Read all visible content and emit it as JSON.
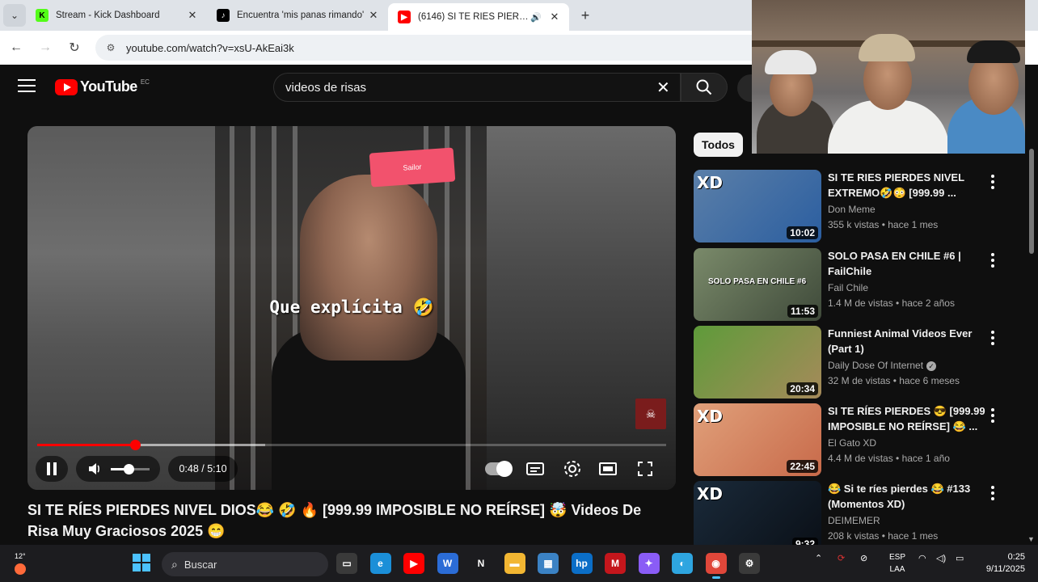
{
  "browser": {
    "tabs": [
      {
        "title": "Stream - Kick Dashboard",
        "favicon": "kick-icon",
        "color": "#53fc18",
        "fav_text": "K"
      },
      {
        "title": "Encuentra 'mis panas rimando'",
        "favicon": "tiktok-icon",
        "color": "#000000",
        "fav_text": "♪"
      },
      {
        "title": "(6146) SI TE RÍES PIERDES N",
        "favicon": "youtube-icon",
        "color": "#ff0000",
        "fav_text": "▶",
        "audio": true
      }
    ],
    "url": "youtube.com/watch?v=xsU-AkEai3k"
  },
  "youtube": {
    "logo_text": "YouTube",
    "country_code": "EC",
    "search_query": "videos de risas"
  },
  "player": {
    "caption": "Que explícita",
    "caption_emoji": "🤣",
    "card_text": "Sailor",
    "time_display": "0:48 / 5:10",
    "progress_fraction": 0.155,
    "volume_fraction": 0.45,
    "title": "SI TE RÍES PIERDES NIVEL DIOS😂 🤣 🔥 [999.99 IMPOSIBLE NO REÍRSE] 🤯 Videos De Risa Muy Graciosos 2025 😁"
  },
  "sidebar": {
    "chip": "Todos",
    "recommendations": [
      {
        "title": "SI TE RIES PIERDES NIVEL EXTREMO🤣😳 [999.99 ...",
        "channel": "Don Meme",
        "meta": "355 k vistas • hace 1 mes",
        "duration": "10:02",
        "thumb_label": "XD",
        "thumb_tag": "",
        "colors": [
          "#5b7fa8",
          "#2b5ea0"
        ],
        "verified": false
      },
      {
        "title": "SOLO PASA EN CHILE #6 | FailChile",
        "channel": "Fail Chile",
        "meta": "1.4 M de vistas • hace 2 años",
        "duration": "11:53",
        "thumb_label": "",
        "thumb_tag": "SOLO PASA EN CHILE #6",
        "colors": [
          "#7a8a6a",
          "#3f4a3a"
        ],
        "verified": false
      },
      {
        "title": "Funniest Animal Videos Ever (Part 1)",
        "channel": "Daily Dose Of Internet",
        "meta": "32 M de vistas • hace 6 meses",
        "duration": "20:34",
        "thumb_label": "",
        "thumb_tag": "",
        "colors": [
          "#5e9b3a",
          "#a68a5a"
        ],
        "verified": true
      },
      {
        "title": "SI TE RÍES PIERDES 😎 [999.99 IMPOSIBLE NO REÍRSE] 😂 ...",
        "channel": "El Gato XD",
        "meta": "4.4 M de vistas • hace 1 año",
        "duration": "22:45",
        "thumb_label": "XD",
        "thumb_tag": "",
        "colors": [
          "#e0a07a",
          "#c86a4a"
        ],
        "verified": false
      },
      {
        "title": "😂 Si te ríes pierdes 😂 #133 (Momentos XD)",
        "channel": "DEIMEMER",
        "meta": "208 k vistas • hace 1 mes",
        "duration": "9:32",
        "thumb_label": "XD",
        "thumb_tag": "",
        "colors": [
          "#1a2a3a",
          "#0a0f16"
        ],
        "verified": false
      }
    ]
  },
  "taskbar": {
    "weather": "12°",
    "search_placeholder": "Buscar",
    "lang_line1": "ESP",
    "lang_line2": "LAA",
    "time": "0:25",
    "date": "9/11/2025",
    "apps": [
      {
        "name": "file-explorer-dark-icon",
        "color": "#3a3a3a",
        "glyph": "▭"
      },
      {
        "name": "edge-icon",
        "color": "#1b8fd8",
        "glyph": "e"
      },
      {
        "name": "youtube-app-icon",
        "color": "#ff0000",
        "glyph": "▶"
      },
      {
        "name": "word-icon",
        "color": "#2b6cd6",
        "glyph": "W"
      },
      {
        "name": "netflix-icon",
        "color": "#1c1c1f",
        "glyph": "N"
      },
      {
        "name": "folder-icon",
        "color": "#f2b632",
        "glyph": "▬"
      },
      {
        "name": "store-icon",
        "color": "#3b82c4",
        "glyph": "▦"
      },
      {
        "name": "hp-icon",
        "color": "#0b6ec7",
        "glyph": "hp"
      },
      {
        "name": "mcafee-icon",
        "color": "#c4161c",
        "glyph": "M"
      },
      {
        "name": "copilot-icon",
        "color": "#8a5cf6",
        "glyph": "✦"
      },
      {
        "name": "lens-icon",
        "color": "#2ea5e0",
        "glyph": "◐"
      },
      {
        "name": "chrome-icon",
        "color": "#e0473a",
        "glyph": "◉",
        "active": true
      },
      {
        "name": "recorder-icon",
        "color": "#3a3a3a",
        "glyph": "⚙"
      }
    ]
  }
}
